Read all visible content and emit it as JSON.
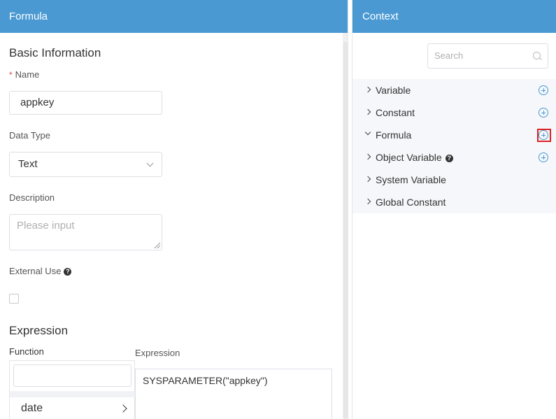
{
  "left_panel": {
    "title": "Formula",
    "basic_info": {
      "section_title": "Basic Information",
      "name_required_mark": "*",
      "name_label": "Name",
      "name_value": "appkey",
      "data_type_label": "Data Type",
      "data_type_value": "Text",
      "description_label": "Description",
      "description_placeholder": "Please input",
      "external_use_label": "External Use",
      "external_use_checked": false
    },
    "expression": {
      "section_title": "Expression",
      "function_label": "Function",
      "function_items": [
        "date"
      ],
      "expression_label": "Expression",
      "expression_value": "SYSPARAMETER(\"appkey\")"
    }
  },
  "right_panel": {
    "title": "Context",
    "search_placeholder": "Search",
    "tree": [
      {
        "label": "Variable",
        "expanded": false,
        "has_add": true,
        "has_help": false
      },
      {
        "label": "Constant",
        "expanded": false,
        "has_add": true,
        "has_help": false
      },
      {
        "label": "Formula",
        "expanded": true,
        "has_add": true,
        "has_help": false,
        "highlighted": true
      },
      {
        "label": "Object Variable",
        "expanded": false,
        "has_add": true,
        "has_help": true
      },
      {
        "label": "System Variable",
        "expanded": false,
        "has_add": false,
        "has_help": false
      },
      {
        "label": "Global Constant",
        "expanded": false,
        "has_add": false,
        "has_help": false
      }
    ]
  },
  "colors": {
    "header_bg": "#4a99d3",
    "accent": "#4a99d3",
    "highlight": "#e02020",
    "tree_bg": "#f5f7fa"
  },
  "help_glyph": "?"
}
